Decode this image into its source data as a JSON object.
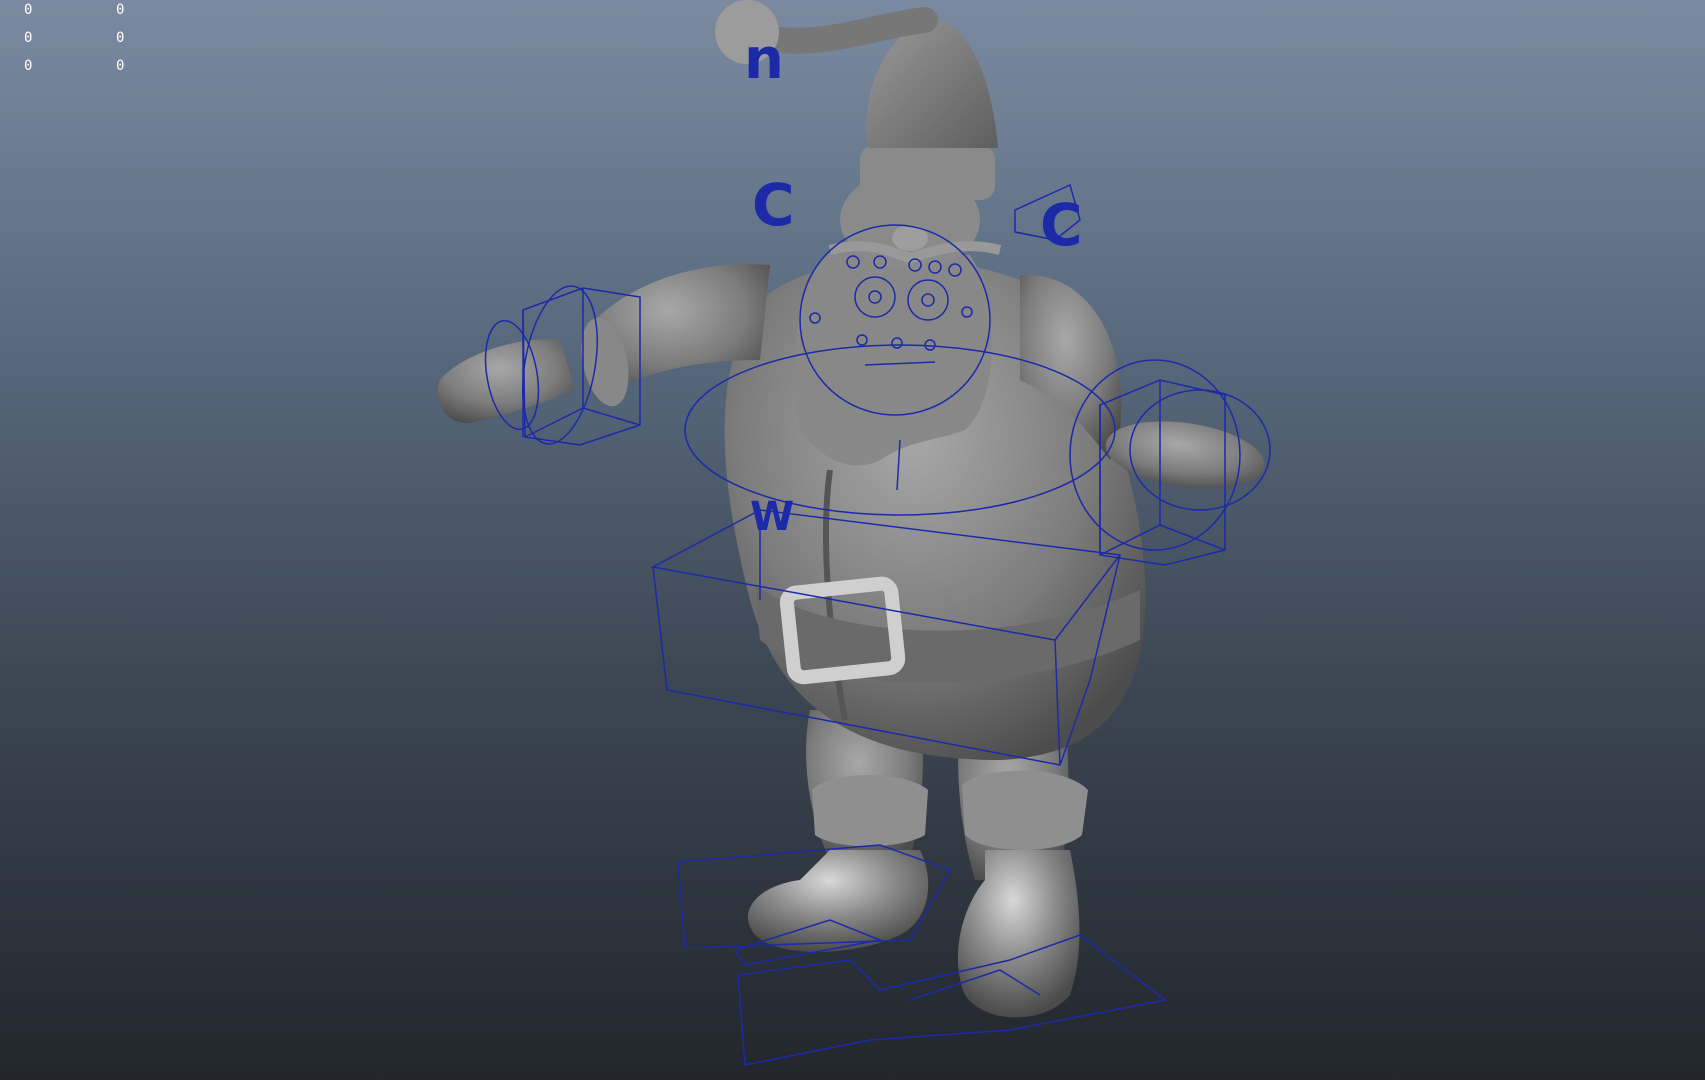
{
  "hud": {
    "rows": [
      [
        "0",
        "0"
      ],
      [
        "0",
        "0"
      ],
      [
        "0",
        "0"
      ]
    ]
  },
  "rig_labels": {
    "head_left": "C",
    "head_right": "C",
    "hat_top": "n",
    "waist": "W"
  },
  "colors": {
    "control_curve": "#1c2aa8",
    "mesh_base": "#7a7a7a",
    "mesh_highlight": "#b5b5b5",
    "hud_text": "#ffffff"
  },
  "icons": [
    "ik-hand-control",
    "head-control",
    "hip-control",
    "foot-control",
    "face-control"
  ]
}
